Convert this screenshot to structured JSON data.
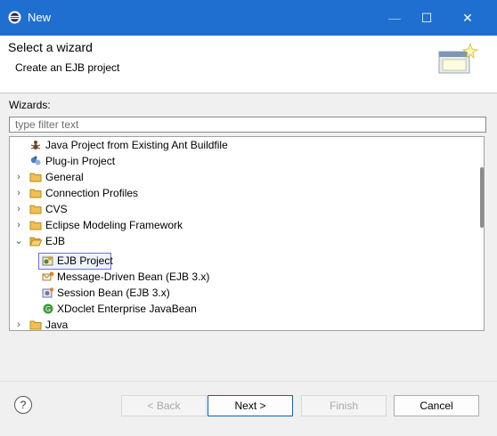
{
  "window": {
    "title": "New"
  },
  "header": {
    "title": "Select a wizard",
    "description": "Create an EJB project"
  },
  "wizards": {
    "label": "Wizards:",
    "filter_placeholder": "type filter text",
    "items": [
      {
        "label": "Java Project from Existing Ant Buildfile",
        "icon": "ant-icon"
      },
      {
        "label": "Plug-in Project",
        "icon": "plugin-icon"
      },
      {
        "label": "General",
        "icon": "folder-icon",
        "expanded": false
      },
      {
        "label": "Connection Profiles",
        "icon": "folder-icon",
        "expanded": false
      },
      {
        "label": "CVS",
        "icon": "folder-icon",
        "expanded": false
      },
      {
        "label": "Eclipse Modeling Framework",
        "icon": "folder-icon",
        "expanded": false
      },
      {
        "label": "EJB",
        "icon": "folder-icon",
        "expanded": true
      },
      {
        "label": "EJB Project",
        "icon": "ejb-project-icon",
        "selected": true
      },
      {
        "label": "Message-Driven Bean (EJB 3.x)",
        "icon": "message-bean-icon"
      },
      {
        "label": "Session Bean (EJB 3.x)",
        "icon": "session-bean-icon"
      },
      {
        "label": "XDoclet Enterprise JavaBean",
        "icon": "xdoclet-icon"
      },
      {
        "label": "Java",
        "icon": "folder-icon",
        "expanded": false
      }
    ]
  },
  "footer": {
    "help": "?",
    "back": "< Back",
    "next": "Next >",
    "finish": "Finish",
    "cancel": "Cancel"
  },
  "colors": {
    "titlebar": "#1f6fd0",
    "selection_border": "#6b6bff",
    "default_button_border": "#0067c0"
  }
}
